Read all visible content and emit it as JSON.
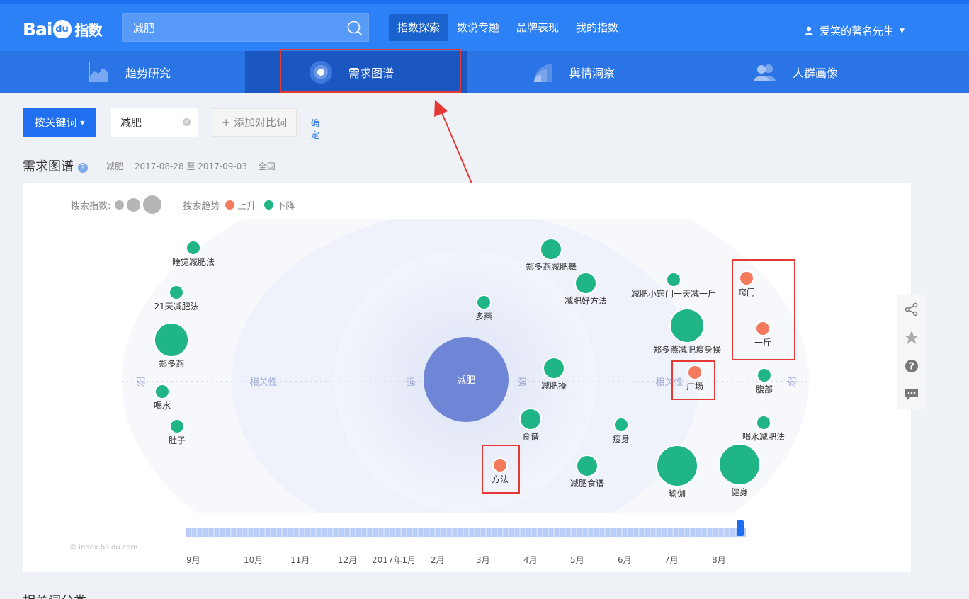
{
  "header": {
    "logo_text": "Bai",
    "logo_du": "du",
    "logo_zh": "指数",
    "search_value": "减肥",
    "nav": [
      "指数探索",
      "数说专题",
      "品牌表现",
      "我的指数"
    ],
    "active_nav": "指数探索",
    "username": "爱笑的著名先生"
  },
  "subnav": {
    "tabs": [
      {
        "label": "趋势研究",
        "icon": "trend-chart-icon"
      },
      {
        "label": "需求图谱",
        "icon": "demand-map-icon"
      },
      {
        "label": "舆情洞察",
        "icon": "sentiment-signal-icon"
      },
      {
        "label": "人群画像",
        "icon": "user-group-icon"
      }
    ],
    "active": "需求图谱"
  },
  "controls": {
    "keyword_button": "按关键词",
    "keyword": "减肥",
    "add_compare": "添加对比词",
    "confirm": "确定"
  },
  "section": {
    "title": "需求图谱",
    "keyword": "减肥",
    "date_range": "2017-08-28 至 2017-09-03",
    "region": "全国"
  },
  "legend": {
    "search_index": "搜索指数:",
    "search_trend": "搜索趋势",
    "up": "上升",
    "down": "下降"
  },
  "colors": {
    "up": "#f47a5e",
    "down": "#1fb587",
    "center": "#6f86d6",
    "accent": "#2d81f7"
  },
  "chart_data": {
    "type": "scatter",
    "center": "减肥",
    "axis_labels": {
      "weak": "弱",
      "relevance": "相关性",
      "strong": "强"
    },
    "nodes": [
      {
        "label": "睡觉减肥法",
        "trend": "down",
        "size": "small"
      },
      {
        "label": "21天减肥法",
        "trend": "down",
        "size": "small"
      },
      {
        "label": "郑多燕",
        "trend": "down",
        "size": "large"
      },
      {
        "label": "喝水",
        "trend": "down",
        "size": "small"
      },
      {
        "label": "肚子",
        "trend": "down",
        "size": "small"
      },
      {
        "label": "郑多燕减肥舞",
        "trend": "down",
        "size": "medium"
      },
      {
        "label": "减肥好方法",
        "trend": "down",
        "size": "medium"
      },
      {
        "label": "多燕",
        "trend": "down",
        "size": "small"
      },
      {
        "label": "减肥小窍门一天减一斤",
        "trend": "down",
        "size": "small"
      },
      {
        "label": "窍门",
        "trend": "up",
        "size": "small"
      },
      {
        "label": "一斤",
        "trend": "up",
        "size": "small"
      },
      {
        "label": "郑多燕减肥瘦身操",
        "trend": "down",
        "size": "large"
      },
      {
        "label": "减肥操",
        "trend": "down",
        "size": "medium"
      },
      {
        "label": "广场",
        "trend": "up",
        "size": "small"
      },
      {
        "label": "腹部",
        "trend": "down",
        "size": "small"
      },
      {
        "label": "食谱",
        "trend": "down",
        "size": "medium"
      },
      {
        "label": "瘦身",
        "trend": "down",
        "size": "small"
      },
      {
        "label": "喝水减肥法",
        "trend": "down",
        "size": "small"
      },
      {
        "label": "方法",
        "trend": "up",
        "size": "small"
      },
      {
        "label": "减肥食谱",
        "trend": "down",
        "size": "medium"
      },
      {
        "label": "瑜伽",
        "trend": "down",
        "size": "xlarge"
      },
      {
        "label": "健身",
        "trend": "down",
        "size": "xlarge"
      }
    ]
  },
  "timeline": {
    "months": [
      "9月",
      "10月",
      "11月",
      "12月",
      "2017年1月",
      "2月",
      "3月",
      "4月",
      "5月",
      "6月",
      "7月",
      "8月"
    ],
    "watermark": "© index.baidu.com"
  },
  "next_section": {
    "title": "相关词分类"
  }
}
